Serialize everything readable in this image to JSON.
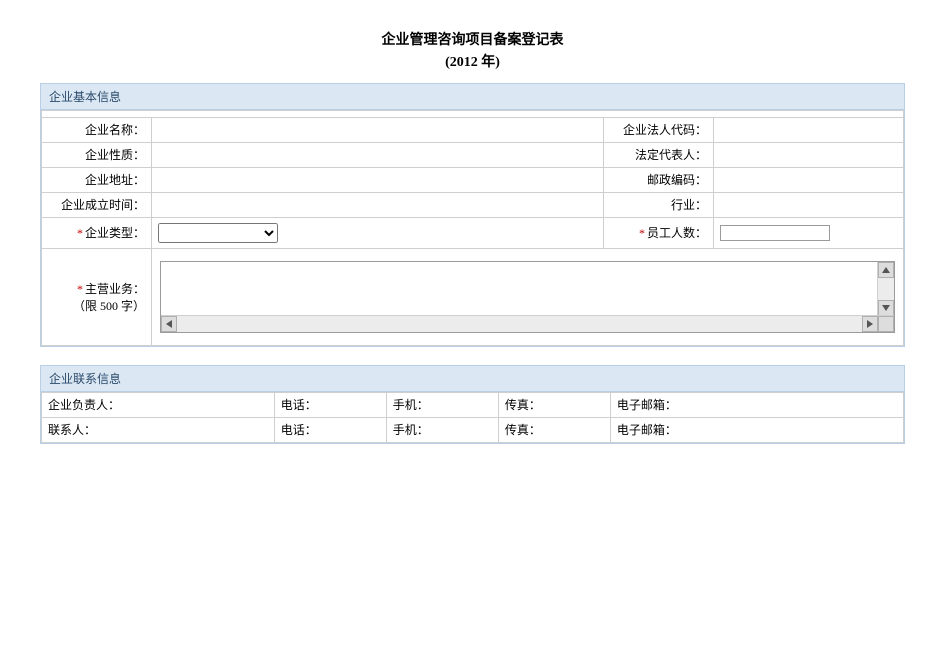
{
  "title": {
    "line1": "企业管理咨询项目备案登记表",
    "line2": "(2012 年)"
  },
  "panels": {
    "basic": "企业基本信息",
    "contact": "企业联系信息"
  },
  "labels": {
    "company_name": "企业名称：",
    "legal_code": "企业法人代码：",
    "company_nature": "企业性质：",
    "legal_rep": "法定代表人：",
    "company_address": "企业地址：",
    "postcode": "邮政编码：",
    "founded": "企业成立时间：",
    "industry": "行业：",
    "company_type": "企业类型：",
    "employee_count": "员工人数：",
    "main_business": "主营业务：",
    "limit_note": "（限 500 字）",
    "contact_owner": "企业负责人：",
    "contact_person": "联系人：",
    "phone": "电话：",
    "mobile": "手机：",
    "fax": "传真：",
    "email": "电子邮箱："
  },
  "values": {
    "company_name": "",
    "legal_code": "",
    "company_nature": "",
    "legal_rep": "",
    "company_address": "",
    "postcode": "",
    "founded": "",
    "industry": "",
    "company_type_selected": "",
    "employee_count": "",
    "main_business": "",
    "owner_name": "",
    "owner_phone": "",
    "owner_mobile": "",
    "owner_fax": "",
    "owner_email": "",
    "contact_name": "",
    "contact_phone": "",
    "contact_mobile": "",
    "contact_fax": "",
    "contact_email": ""
  }
}
